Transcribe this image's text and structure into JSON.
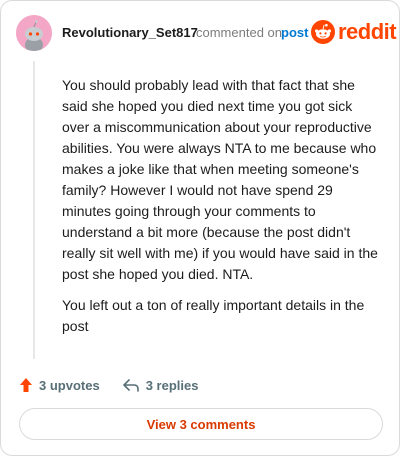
{
  "header": {
    "username": "Revolutionary_Set817",
    "commented_text": "commented on",
    "post_link": "post",
    "logo_word": "reddit"
  },
  "comment": {
    "paragraphs": [
      "You should probably lead with that fact that she said she hoped you died next time you got sick over a miscommunication about your reproductive abilities. You were always NTA to me because who makes a joke like that when meeting someone's family? However I would not have spend 29 minutes going through your comments to understand a bit more (because the post didn't really sit well with me) if you would have said in the post she hoped you died. NTA.",
      "You left out a ton of really important details in the post"
    ]
  },
  "actions": {
    "upvotes": "3 upvotes",
    "replies": "3 replies"
  },
  "footer": {
    "view_comments": "View 3 comments"
  },
  "colors": {
    "accent": "#ff4500",
    "link": "#0079d3",
    "button_text": "#d93a00",
    "avatar_bg": "#f3a6c5"
  },
  "icons": {
    "avatar": "snoo-avatar-icon",
    "logo": "reddit-logo-icon",
    "upvote": "upvote-arrow-icon",
    "reply": "reply-arrow-icon"
  }
}
